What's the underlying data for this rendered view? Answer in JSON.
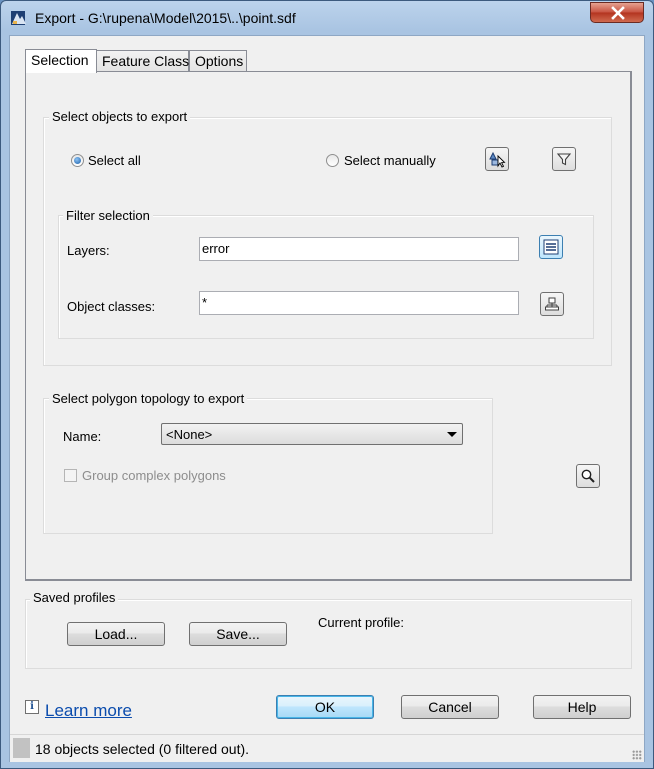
{
  "window": {
    "title": "Export - G:\\rupena\\Model\\2015\\..\\point.sdf",
    "close_label": "✕"
  },
  "tabs": [
    {
      "label": "Selection",
      "active": true
    },
    {
      "label": "Feature Class",
      "active": false
    },
    {
      "label": "Options",
      "active": false
    }
  ],
  "selection": {
    "group_title": "Select objects to export",
    "select_all_label": "Select all",
    "select_all_checked": true,
    "select_manually_label": "Select manually",
    "select_manually_checked": false,
    "filter": {
      "group_title": "Filter selection",
      "layers_label": "Layers:",
      "layers_value": "error",
      "object_classes_label": "Object classes:",
      "object_classes_value": "*"
    }
  },
  "topology": {
    "group_title": "Select polygon topology to export",
    "name_label": "Name:",
    "name_value": "<None>",
    "group_complex_label": "Group complex polygons",
    "group_complex_checked": false
  },
  "profiles": {
    "group_title": "Saved profiles",
    "load_label": "Load...",
    "save_label": "Save...",
    "current_profile_label": "Current profile:"
  },
  "footer": {
    "learn_more": "Learn more",
    "info_glyph": "i",
    "ok_label": "OK",
    "cancel_label": "Cancel",
    "help_label": "Help"
  },
  "status": {
    "text": "18 objects selected (0 filtered out)."
  },
  "colors": {
    "title_bar": "#a9c4e2",
    "close_button": "#c7513f",
    "link": "#0b4cad",
    "default_button": "#bee6fd"
  }
}
